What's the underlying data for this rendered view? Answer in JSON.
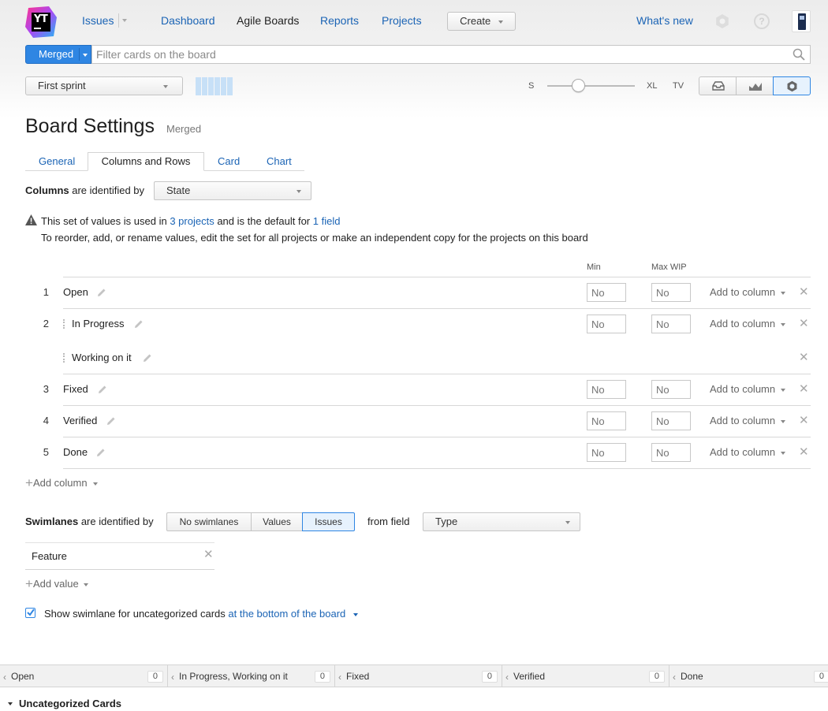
{
  "header": {
    "logo_text": "YT",
    "nav": {
      "issues": "Issues",
      "dashboard": "Dashboard",
      "agile_boards": "Agile Boards",
      "reports": "Reports",
      "projects": "Projects",
      "create": "Create",
      "whats_new": "What's new"
    }
  },
  "search": {
    "board_button": "Merged",
    "placeholder": "Filter cards on the board"
  },
  "toolbar": {
    "sprint": "First sprint",
    "size_small": "S",
    "size_large": "XL",
    "tv": "TV",
    "card_size_fraction": 0.33
  },
  "page": {
    "title": "Board Settings",
    "board_name": "Merged"
  },
  "tabs": [
    "General",
    "Columns and Rows",
    "Card",
    "Chart"
  ],
  "columns": {
    "label_bold": "Columns",
    "label_rest": "are identified by",
    "field": "State",
    "notice": {
      "prefix": "This set of values is used in",
      "projects_link": "3 projects",
      "mid": "and is the default for",
      "field_link": "1 field",
      "line2": "To reorder, add, or rename values, edit the set for all projects or make an independent copy for the projects on this board"
    },
    "header_min": "Min",
    "header_max": "Max WIP",
    "input_placeholder": "No",
    "add_to_column": "Add to column",
    "rows": [
      {
        "num": "1",
        "name": "Open"
      },
      {
        "num": "2",
        "name": "In Progress"
      },
      {
        "num": "",
        "name": "Working on it"
      },
      {
        "num": "3",
        "name": "Fixed"
      },
      {
        "num": "4",
        "name": "Verified"
      },
      {
        "num": "5",
        "name": "Done"
      }
    ],
    "add_column": "Add column"
  },
  "swimlanes": {
    "label_bold": "Swimlanes",
    "label_rest": "are identified by",
    "options": [
      "No swimlanes",
      "Values",
      "Issues"
    ],
    "selected": "Issues",
    "from_field": "from field",
    "field": "Type",
    "values": [
      "Feature"
    ],
    "add_value": "Add value",
    "show_uncat_label": "Show swimlane for uncategorized cards",
    "show_uncat_position": "at the bottom of the board",
    "show_uncat_checked": true
  },
  "board_columns": [
    {
      "name": "Open",
      "count": "0"
    },
    {
      "name": "In Progress, Working on it",
      "count": "0"
    },
    {
      "name": "Fixed",
      "count": "0"
    },
    {
      "name": "Verified",
      "count": "0"
    },
    {
      "name": "Done",
      "count": "0"
    }
  ],
  "uncategorized": "Uncategorized Cards",
  "colors": {
    "link": "#1b64b5",
    "accent": "#2f86e3",
    "sprint_bar": "#c7e0f7"
  }
}
